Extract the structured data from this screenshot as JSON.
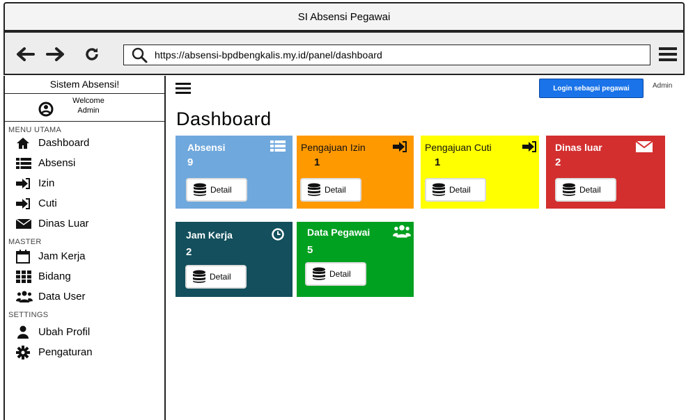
{
  "window": {
    "title": "SI Absensi Pegawai"
  },
  "browser": {
    "url": "https://absensi-bpdbengkalis.my.id/panel/dashboard"
  },
  "sidebar": {
    "brand": "Sistem Absensi!",
    "welcome": "Welcome",
    "user": "Admin",
    "sections": {
      "menu_utama": "MENU UTAMA",
      "master": "MASTER",
      "settings": "SETTINGS"
    },
    "items": [
      {
        "label": "Dashboard",
        "icon": "home-icon"
      },
      {
        "label": "Absensi",
        "icon": "list-icon"
      },
      {
        "label": "Izin",
        "icon": "sign-in-icon"
      },
      {
        "label": "Cuti",
        "icon": "sign-in-icon"
      },
      {
        "label": "Dinas Luar",
        "icon": "envelope-icon"
      },
      {
        "label": "Jam Kerja",
        "icon": "calendar-icon"
      },
      {
        "label": "Bidang",
        "icon": "grid-icon"
      },
      {
        "label": "Data User",
        "icon": "users-icon"
      },
      {
        "label": "Ubah Profil",
        "icon": "user-icon"
      },
      {
        "label": "Pengaturan",
        "icon": "cog-icon"
      }
    ]
  },
  "header": {
    "login_button": "Login sebagai pegawai",
    "admin": "Admin",
    "page_title": "Dashboard"
  },
  "cards": [
    {
      "title": "Absensi",
      "count": "9",
      "detail": "Detail",
      "color": "#6fa8dc",
      "icon": "list-icon"
    },
    {
      "title": "Pengajuan Izin",
      "count": "1",
      "detail": "Detail",
      "color": "#ff9900",
      "icon": "sign-in-icon"
    },
    {
      "title": "Pengajuan Cuti",
      "count": "1",
      "detail": "Detail",
      "color": "#ffff00",
      "icon": "sign-in-icon"
    },
    {
      "title": "Dinas luar",
      "count": "2",
      "detail": "Detail",
      "color": "#d32f2f",
      "icon": "envelope-icon"
    },
    {
      "title": "Jam Kerja",
      "count": "2",
      "detail": "Detail",
      "color": "#134f5c",
      "icon": "clock-icon"
    },
    {
      "title": "Data Pegawai",
      "count": "5",
      "detail": "Detail",
      "color": "#00a020",
      "icon": "users-icon"
    }
  ]
}
